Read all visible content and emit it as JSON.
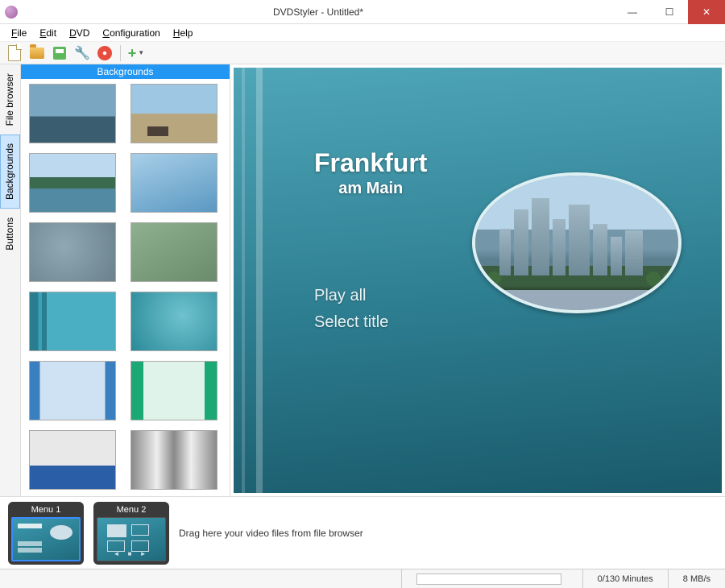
{
  "window": {
    "title": "DVDStyler - Untitled*"
  },
  "menus": {
    "file": "File",
    "edit": "Edit",
    "dvd": "DVD",
    "configuration": "Configuration",
    "help": "Help"
  },
  "sidetabs": {
    "file_browser": "File browser",
    "backgrounds": "Backgrounds",
    "buttons": "Buttons"
  },
  "panel": {
    "header": "Backgrounds"
  },
  "preview": {
    "title": "Frankfurt",
    "subtitle": "am Main",
    "play_all": "Play all",
    "select_title": "Select title"
  },
  "timeline": {
    "menu1": "Menu 1",
    "menu2": "Menu 2",
    "drop_hint": "Drag here your video files from file browser"
  },
  "status": {
    "duration": "0/130 Minutes",
    "bitrate": "8 MB/s"
  }
}
